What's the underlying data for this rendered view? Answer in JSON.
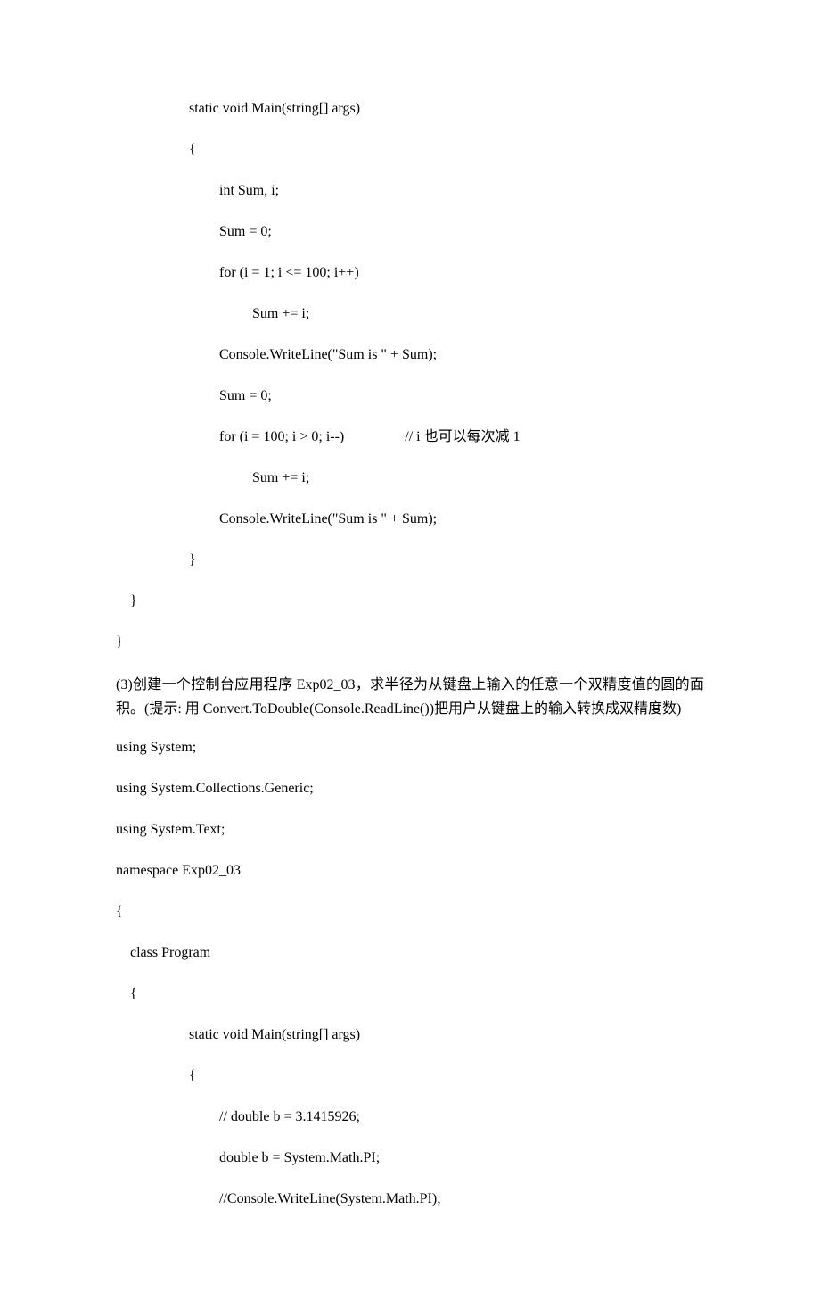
{
  "code_block_1": {
    "lines": [
      {
        "indent": "indent-1",
        "text": "static void Main(string[] args)"
      },
      {
        "indent": "indent-1",
        "text": "{"
      },
      {
        "indent": "indent-2",
        "text": "int Sum, i;"
      },
      {
        "indent": "indent-2",
        "text": "Sum = 0;"
      },
      {
        "indent": "indent-2",
        "text": "for (i = 1; i <= 100; i++)"
      },
      {
        "indent": "indent-3",
        "text": "Sum += i;"
      },
      {
        "indent": "indent-2",
        "text": "Console.WriteLine(\"Sum is \" + Sum);"
      },
      {
        "indent": "indent-2",
        "text": "Sum = 0;"
      },
      {
        "indent": "indent-2",
        "text": "for (i = 100; i > 0; i--)                 // i 也可以每次减 1"
      },
      {
        "indent": "indent-3",
        "text": "Sum += i;"
      },
      {
        "indent": "indent-2",
        "text": "Console.WriteLine(\"Sum is \" + Sum);"
      },
      {
        "indent": "indent-1",
        "text": "}"
      },
      {
        "indent": "",
        "text": "    }"
      },
      {
        "indent": "",
        "text": "}"
      }
    ]
  },
  "paragraph": "(3)创建一个控制台应用程序 Exp02_03，求半径为从键盘上输入的任意一个双精度值的圆的面积。(提示: 用 Convert.ToDouble(Console.ReadLine())把用户从键盘上的输入转换成双精度数)",
  "code_block_2": {
    "lines": [
      {
        "indent": "",
        "text": "using System;"
      },
      {
        "indent": "",
        "text": "using System.Collections.Generic;"
      },
      {
        "indent": "",
        "text": "using System.Text;"
      },
      {
        "indent": "",
        "text": "namespace Exp02_03"
      },
      {
        "indent": "",
        "text": "{"
      },
      {
        "indent": "",
        "text": "    class Program"
      },
      {
        "indent": "",
        "text": "    {"
      },
      {
        "indent": "indent-1",
        "text": "static void Main(string[] args)"
      },
      {
        "indent": "indent-1",
        "text": "{"
      },
      {
        "indent": "indent-2",
        "text": "// double b = 3.1415926;"
      },
      {
        "indent": "indent-2",
        "text": "double b = System.Math.PI;"
      },
      {
        "indent": "indent-2",
        "text": "//Console.WriteLine(System.Math.PI);"
      }
    ]
  }
}
